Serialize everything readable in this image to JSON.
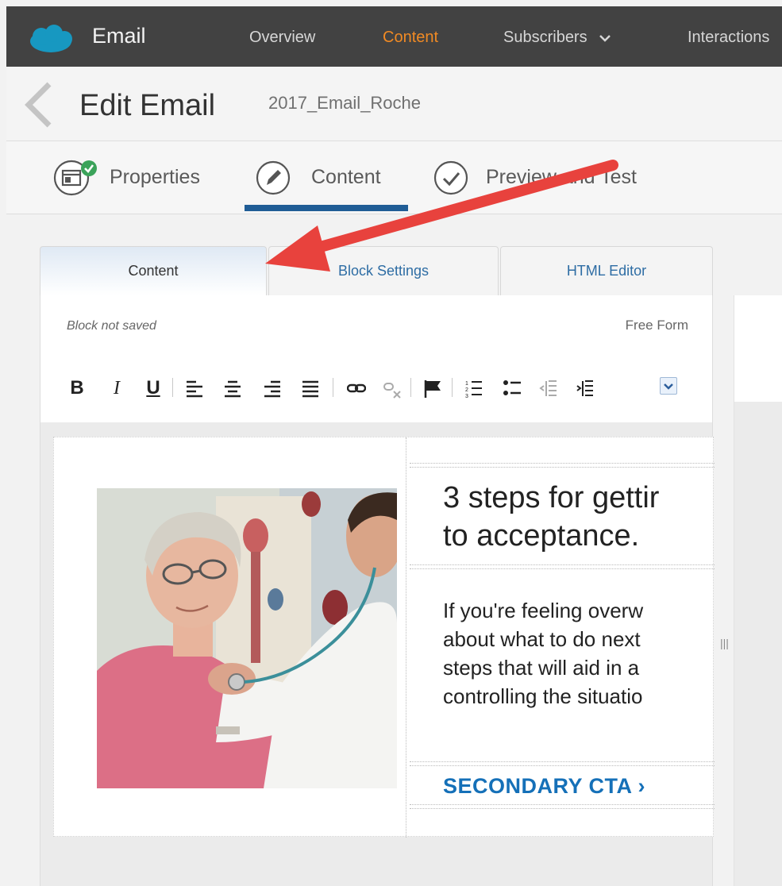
{
  "app": {
    "title": "Email"
  },
  "nav": {
    "items": [
      {
        "label": "Overview",
        "active": false
      },
      {
        "label": "Content",
        "active": true
      },
      {
        "label": "Subscribers",
        "active": false
      },
      {
        "label": "Interactions",
        "active": false
      }
    ]
  },
  "header": {
    "title": "Edit Email",
    "email_name": "2017_Email_Roche"
  },
  "steps": [
    {
      "label": "Properties",
      "icon": "properties-icon",
      "complete": true
    },
    {
      "label": "Content",
      "icon": "pencil-icon",
      "active": true
    },
    {
      "label": "Preview and Test",
      "icon": "checkmark-icon"
    }
  ],
  "editor_tabs": [
    "Content",
    "Block Settings",
    "HTML Editor"
  ],
  "editor": {
    "status": "Block not saved",
    "layout": "Free Form",
    "toolbar": [
      "bold",
      "italic",
      "underline",
      "align-left",
      "align-center",
      "align-right",
      "justify",
      "link",
      "unlink",
      "anchor",
      "numbered-list",
      "bulleted-list",
      "outdent",
      "indent",
      "more"
    ]
  },
  "email": {
    "headline_line1": "3 steps for gettir",
    "headline_line2": "to acceptance.",
    "body_lines": [
      "If you're feeling overw",
      "about what to do next",
      "steps that will aid in a",
      "controlling the situatio"
    ],
    "cta": "SECONDARY CTA ›"
  },
  "colors": {
    "nav_bg": "#424242",
    "active_nav": "#f08a24",
    "link_blue": "#1570b8",
    "underline": "#205d96",
    "arrow": "#e8423d"
  }
}
